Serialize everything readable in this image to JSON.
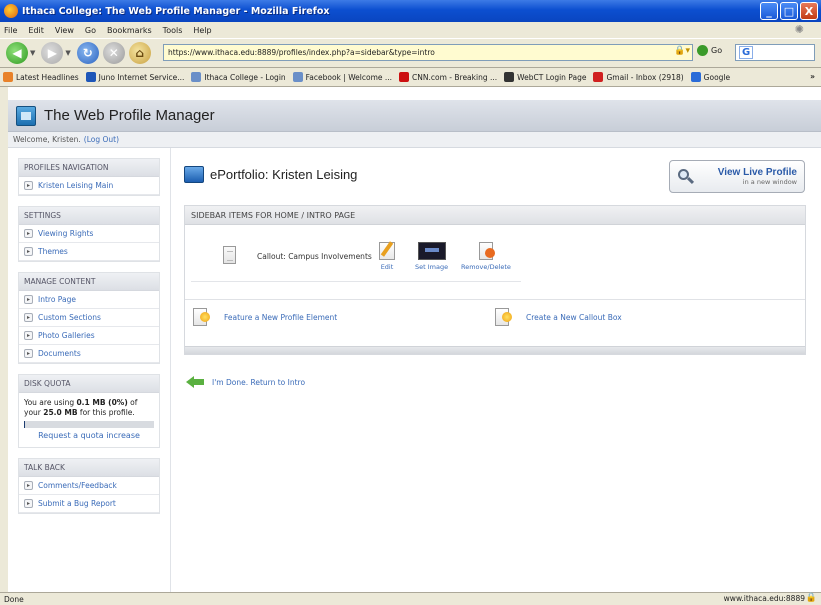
{
  "window": {
    "title": "Ithaca College: The Web Profile Manager - Mozilla Firefox",
    "min_label": "_",
    "max_label": "□",
    "close_label": "X"
  },
  "menu": [
    "File",
    "Edit",
    "View",
    "Go",
    "Bookmarks",
    "Tools",
    "Help"
  ],
  "toolbar": {
    "url": "https://www.ithaca.edu:8889/profiles/index.php?a=sidebar&type=intro",
    "go_label": "Go",
    "search_logo": "G"
  },
  "bookmarks": [
    {
      "label": "Latest Headlines",
      "color": "#e8822a"
    },
    {
      "label": "Juno Internet Service...",
      "color": "#1e56b8"
    },
    {
      "label": "Ithaca College - Login",
      "color": "#6a8fc8"
    },
    {
      "label": "Facebook | Welcome ...",
      "color": "#6a8fc8"
    },
    {
      "label": "CNN.com - Breaking ...",
      "color": "#cc1010"
    },
    {
      "label": "WebCT Login Page",
      "color": "#333333"
    },
    {
      "label": "Gmail - Inbox (2918)",
      "color": "#d02020"
    },
    {
      "label": "Google",
      "color": "#2a6bd8"
    }
  ],
  "bookmarks_more": "»",
  "header": {
    "app_title": "The Web Profile Manager",
    "welcome_text": "Welcome, Kristen.",
    "logout_label": "(Log Out)"
  },
  "sidebar": {
    "profiles_nav": {
      "heading": "PROFILES NAVIGATION",
      "items": [
        "Kristen Leising Main"
      ]
    },
    "settings": {
      "heading": "SETTINGS",
      "items": [
        "Viewing Rights",
        "Themes"
      ]
    },
    "manage": {
      "heading": "MANAGE CONTENT",
      "items": [
        "Intro Page",
        "Custom Sections",
        "Photo Galleries",
        "Documents"
      ]
    },
    "quota": {
      "heading": "DISK QUOTA",
      "text_prefix": "You are using ",
      "used": "0.1 MB (0%)",
      "text_mid": " of your ",
      "total": "25.0 MB",
      "text_suffix": " for this profile.",
      "percent_used": 1,
      "request_label": "Request a quota increase"
    },
    "talkback": {
      "heading": "TALK BACK",
      "items": [
        "Comments/Feedback",
        "Submit a Bug Report"
      ]
    }
  },
  "main": {
    "title": "ePortfolio: Kristen Leising",
    "live_profile": {
      "label": "View Live Profile",
      "sub": "in a new window"
    },
    "panel_heading": "SIDEBAR ITEMS FOR HOME / INTRO PAGE",
    "callout_label": "Callout: Campus Involvements",
    "actions": {
      "edit": "Edit",
      "set_image": "Set Image",
      "remove": "Remove/Delete"
    },
    "feature_label": "Feature a New Profile Element",
    "create_callout_label": "Create a New Callout Box",
    "done_label": "I'm Done. Return to Intro"
  },
  "status": {
    "left": "Done",
    "right": "www.ithaca.edu:8889"
  }
}
